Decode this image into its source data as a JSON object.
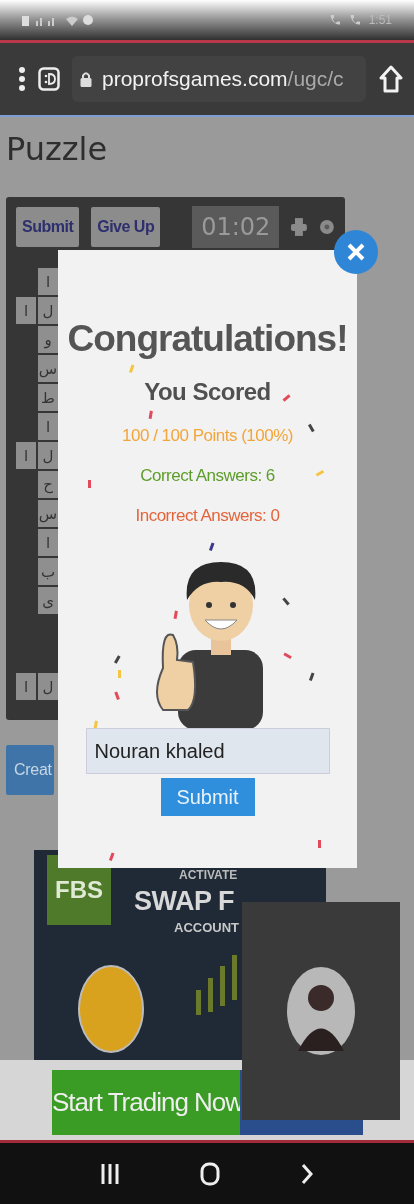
{
  "status_bar": {
    "time": "1:51"
  },
  "browser_bar": {
    "url_host": "proprofsgames.com",
    "url_path": "/ugc/c"
  },
  "page": {
    "title": "Puzzle",
    "toolbar": {
      "submit": "Submit",
      "give_up": "Give Up",
      "timer": "01:02"
    },
    "grid": {
      "rows": [
        {
          "letter": "ا"
        },
        {
          "letter": "ل",
          "side": "ا"
        },
        {
          "letter": "و"
        },
        {
          "letter": "س"
        },
        {
          "letter": "ط"
        },
        {
          "letter": "ا"
        },
        {
          "letter": "ل",
          "side": "ا"
        },
        {
          "letter": "ح"
        },
        {
          "letter": "س"
        },
        {
          "letter": "ا"
        },
        {
          "letter": "ب"
        },
        {
          "letter": "ى"
        }
      ],
      "bottom_row": [
        "ل",
        "ا"
      ]
    },
    "create_button": "Creat",
    "ad": {
      "logo": "FBS",
      "kicker": "ACTIVATE",
      "headline": "SWAP F",
      "subline": "ACCOUNT",
      "cta": "Start Trading Now"
    }
  },
  "modal": {
    "title": "Congratulations!",
    "subtitle": "You Scored",
    "results": [
      {
        "kind": "points",
        "text": "100 / 100 Points (100%)"
      },
      {
        "kind": "correct",
        "text": "Correct Answers: 6"
      },
      {
        "kind": "incorrect",
        "text": "Incorrect Answers: 0"
      }
    ],
    "name_field": {
      "value": "Nouran khaled"
    },
    "submit": "Submit"
  }
}
